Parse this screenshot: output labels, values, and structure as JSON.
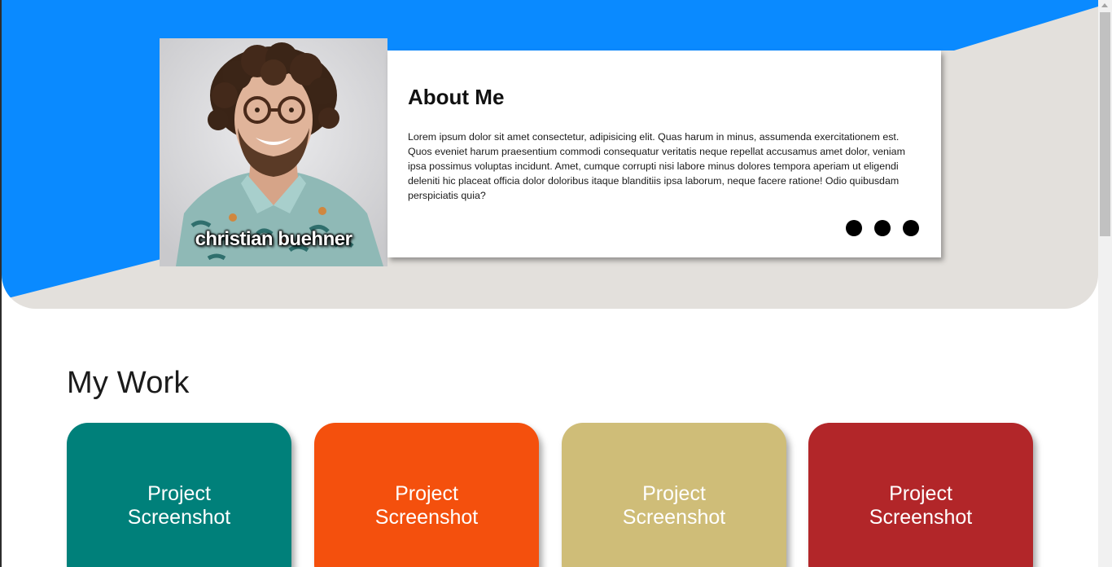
{
  "profile": {
    "name": "christian buehner"
  },
  "about": {
    "title": "About Me",
    "text": "Lorem ipsum dolor sit amet consectetur, adipisicing elit. Quas harum in minus, assumenda exercitationem est. Quos eveniet harum praesentium commodi consequatur veritatis neque repellat accusamus amet dolor, veniam ipsa possimus voluptas incidunt. Amet, cumque corrupti nisi labore minus dolores tempora aperiam ut eligendi deleniti hic placeat officia dolor doloribus itaque blanditiis ipsa laborum, neque facere ratione! Odio quibusdam perspiciatis quia?"
  },
  "work": {
    "title": "My Work",
    "projects": [
      {
        "label": "Project Screenshot",
        "color": "#00807a"
      },
      {
        "label": "Project Screenshot",
        "color": "#f4500d"
      },
      {
        "label": "Project Screenshot",
        "color": "#cfbd78"
      },
      {
        "label": "Project Screenshot",
        "color": "#b22629"
      }
    ]
  },
  "colors": {
    "hero_blue": "#0a8aff",
    "hero_grey": "#e3e0dc"
  }
}
